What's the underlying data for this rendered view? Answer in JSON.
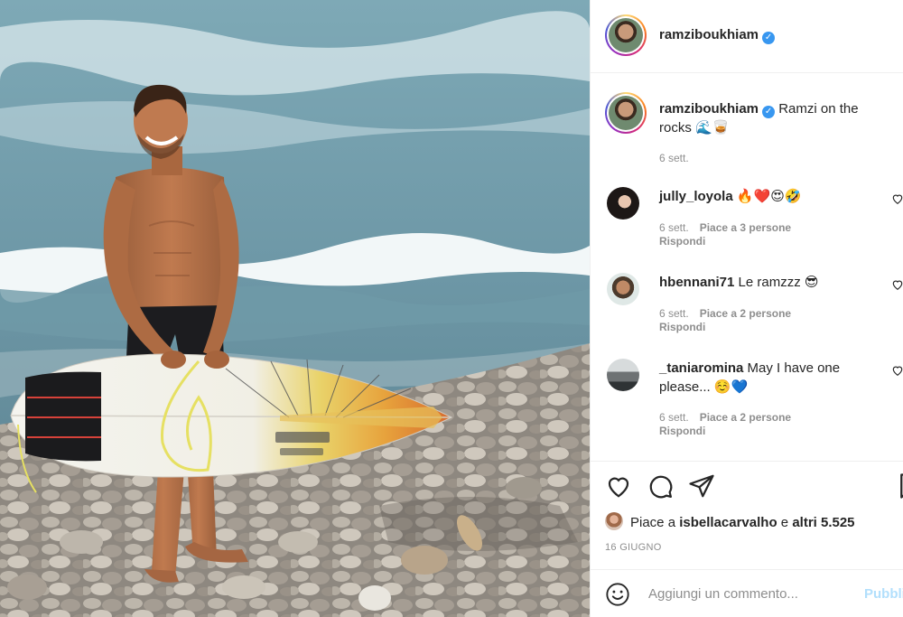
{
  "post": {
    "author": "ramziboukhiam",
    "caption": "Ramzi on the rocks 🌊🥃",
    "caption_time": "6 sett."
  },
  "comments": [
    {
      "user": "jully_loyola",
      "text": "🔥❤️😍🤣",
      "time": "6 sett.",
      "likes": "Piace a 3 persone",
      "reply": "Rispondi"
    },
    {
      "user": "hbennani71",
      "text": "Le ramzzz 😎",
      "time": "6 sett.",
      "likes": "Piace a 2 persone",
      "reply": "Rispondi"
    },
    {
      "user": "_taniaromina",
      "text": "May I have one please... ☺️💙",
      "time": "6 sett.",
      "likes": "Piace a 2 persone",
      "reply": "Rispondi"
    }
  ],
  "likes": {
    "prefix": "Piace a",
    "user": "isbellacarvalho",
    "conjunction": "e",
    "others": "altri 5.525"
  },
  "date": "16 GIUGNO",
  "add_comment": {
    "placeholder": "Aggiungi un commento...",
    "publish": "Pubblica"
  },
  "colors": {
    "verified": "#3897f0",
    "publish": "#b2dffc",
    "like": "#ed4956"
  },
  "icons": [
    "verified-badge-icon",
    "heart-icon",
    "comment-icon",
    "share-icon",
    "bookmark-icon",
    "emoji-icon"
  ]
}
